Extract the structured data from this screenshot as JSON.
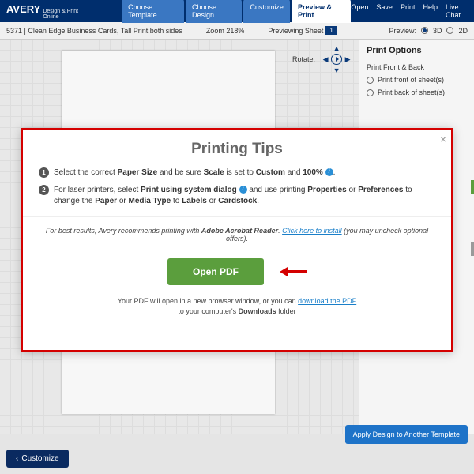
{
  "brand": {
    "name": "AVERY",
    "tagline": "Design & Print Online"
  },
  "topnav": {
    "tabs": [
      "Choose Template",
      "Choose Design",
      "Customize",
      "Preview & Print"
    ],
    "active": 3,
    "links": [
      "Open",
      "Save",
      "Print",
      "Help",
      "Live Chat"
    ]
  },
  "subnav": {
    "title": "5371 | Clean Edge Business Cards, Tall Print both sides",
    "zoom": "Zoom 218%",
    "preview_label": "Previewing Sheet",
    "preview_sheet": "1",
    "view_label": "Preview:",
    "view_3d": "3D",
    "view_2d": "2D"
  },
  "rotate": {
    "label": "Rotate:"
  },
  "sidebar": {
    "title": "Print Options",
    "section": "Print Front & Back",
    "options": [
      "Print front of sheet(s)",
      "Print back of sheet(s)"
    ]
  },
  "modal": {
    "title": "Printing Tips",
    "tip1_a": "Select the correct ",
    "tip1_b": "Paper Size",
    "tip1_c": " and be sure ",
    "tip1_d": "Scale",
    "tip1_e": " is set to ",
    "tip1_f": "Custom",
    "tip1_g": " and ",
    "tip1_h": "100%",
    "tip1_i": ".",
    "tip2_a": "For laser printers, select ",
    "tip2_b": "Print using system dialog",
    "tip2_c": " and use printing ",
    "tip2_d": "Properties",
    "tip2_e": " or ",
    "tip2_f": "Preferences",
    "tip2_g": " to change the ",
    "tip2_h": "Paper",
    "tip2_i": " or ",
    "tip2_j": "Media Type",
    "tip2_k": " to ",
    "tip2_l": "Labels",
    "tip2_m": " or ",
    "tip2_n": "Cardstock",
    "tip2_o": ".",
    "rec_a": "For best results, Avery recommends printing with ",
    "rec_b": "Adobe Acrobat Reader",
    "rec_c": ". ",
    "rec_link": "Click here to install",
    "rec_d": " (you may uncheck optional offers).",
    "open_pdf": "Open PDF",
    "foot_a": "Your PDF will open in a new browser window, or you can ",
    "foot_link": "download the PDF",
    "foot_b": "to your computer's ",
    "foot_c": "Downloads",
    "foot_d": " folder"
  },
  "bottom": {
    "apply": "Apply Design to Another Template",
    "back": "Customize"
  }
}
